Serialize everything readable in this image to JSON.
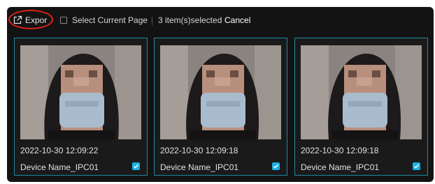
{
  "toolbar": {
    "export_label": "Expor",
    "export_icon": "export-icon",
    "select_current_page_label": "Select Current Page",
    "selected_count_text": "3 item(s)selected",
    "cancel_label": "Cancel"
  },
  "accent_color": "#1bb1e6",
  "highlight_color": "#e2231a",
  "cards": [
    {
      "timestamp": "2022-10-30 12:09:22",
      "device_name": "Device Name_IPC01",
      "checked": true
    },
    {
      "timestamp": "2022-10-30 12:09:18",
      "device_name": "Device Name_IPC01",
      "checked": true
    },
    {
      "timestamp": "2022-10-30 12:09:18",
      "device_name": "Device Name_IPC01",
      "checked": true
    }
  ]
}
